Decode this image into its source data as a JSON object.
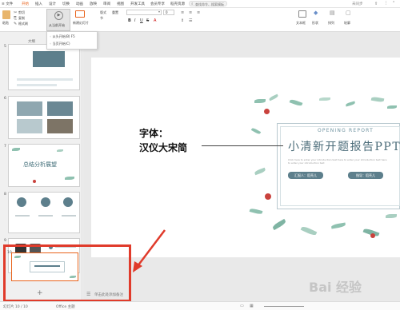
{
  "menubar": {
    "app_menu": "≡ 文件",
    "items": [
      "开始",
      "插入",
      "设计",
      "切换",
      "动画",
      "放映",
      "审阅",
      "视图",
      "开发工具",
      "会员专享",
      "稻壳资源"
    ],
    "active_index": 0,
    "search_placeholder": "查找命令、搜索模板",
    "right_label": "未同步"
  },
  "ribbon": {
    "paste": "粘贴",
    "cut": "剪切",
    "copy": "复制",
    "format_painter": "格式刷",
    "from_start": "从当前开始",
    "new_slide": "新建幻灯片",
    "layout": "版式",
    "section": "节",
    "reset": "重置",
    "font_name": "",
    "font_size": "0",
    "text_box": "文本框",
    "shapes": "形状",
    "arrange": "排列",
    "outline": "轮廓"
  },
  "dropdown": {
    "items": [
      "从头开始(B)   F5",
      "当页开始(C)"
    ]
  },
  "panel": {
    "tab_label": "大纲",
    "slides": [
      {
        "num": "5"
      },
      {
        "num": "6"
      },
      {
        "num": "7",
        "title": "总结分析展望"
      },
      {
        "num": "8"
      },
      {
        "num": "9"
      },
      {
        "num": "10"
      }
    ]
  },
  "slide": {
    "subtitle_en": "OPENING REPORT",
    "title_cn": "小清新开题报告PPT",
    "body_text": "Click here to enter your introduction text here to enter your introduction text here to enter your introduction text",
    "reporter": "汇报人：稻壳儿",
    "teacher": "指导：稻壳儿"
  },
  "annotation": {
    "line1": "字体：",
    "line2": "汉仪大宋简"
  },
  "statusbar": {
    "slide_info": "幻灯片 10 / 10",
    "theme": "Office 主题",
    "notes": "单击此处添加备注",
    "watermark": "Bai 经验"
  },
  "colors": {
    "accent_orange": "#e8631c",
    "slide_teal": "#5d7f8c",
    "highlight_red": "#e03b2b"
  }
}
